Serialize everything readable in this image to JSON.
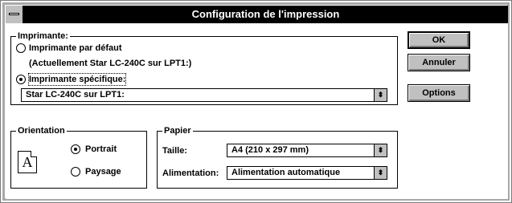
{
  "window": {
    "title": "Configuration de l'impression"
  },
  "imprimante": {
    "group_label": "Imprimante:",
    "default_option_label": "Imprimante par défaut",
    "default_printer_note": "(Actuellement Star LC-240C sur LPT1:)",
    "specific_option_label": "Imprimante spécifique:",
    "specific_printer_value": "Star LC-240C sur LPT1:",
    "selected": "specific"
  },
  "orientation": {
    "group_label": "Orientation",
    "icon_letter": "A",
    "portrait_label": "Portrait",
    "paysage_label": "Paysage",
    "selected": "portrait"
  },
  "papier": {
    "group_label": "Papier",
    "taille_label": "Taille:",
    "taille_value": "A4 (210 x 297 mm)",
    "alimentation_label": "Alimentation:",
    "alimentation_value": "Alimentation automatique"
  },
  "buttons": {
    "ok_label": "OK",
    "annuler_label": "Annuler",
    "options_label": "Options"
  },
  "icons": {
    "combo_arrow": "updown-arrow-icon",
    "system_menu": "system-menu-icon",
    "orientation": "page-a-icon"
  }
}
